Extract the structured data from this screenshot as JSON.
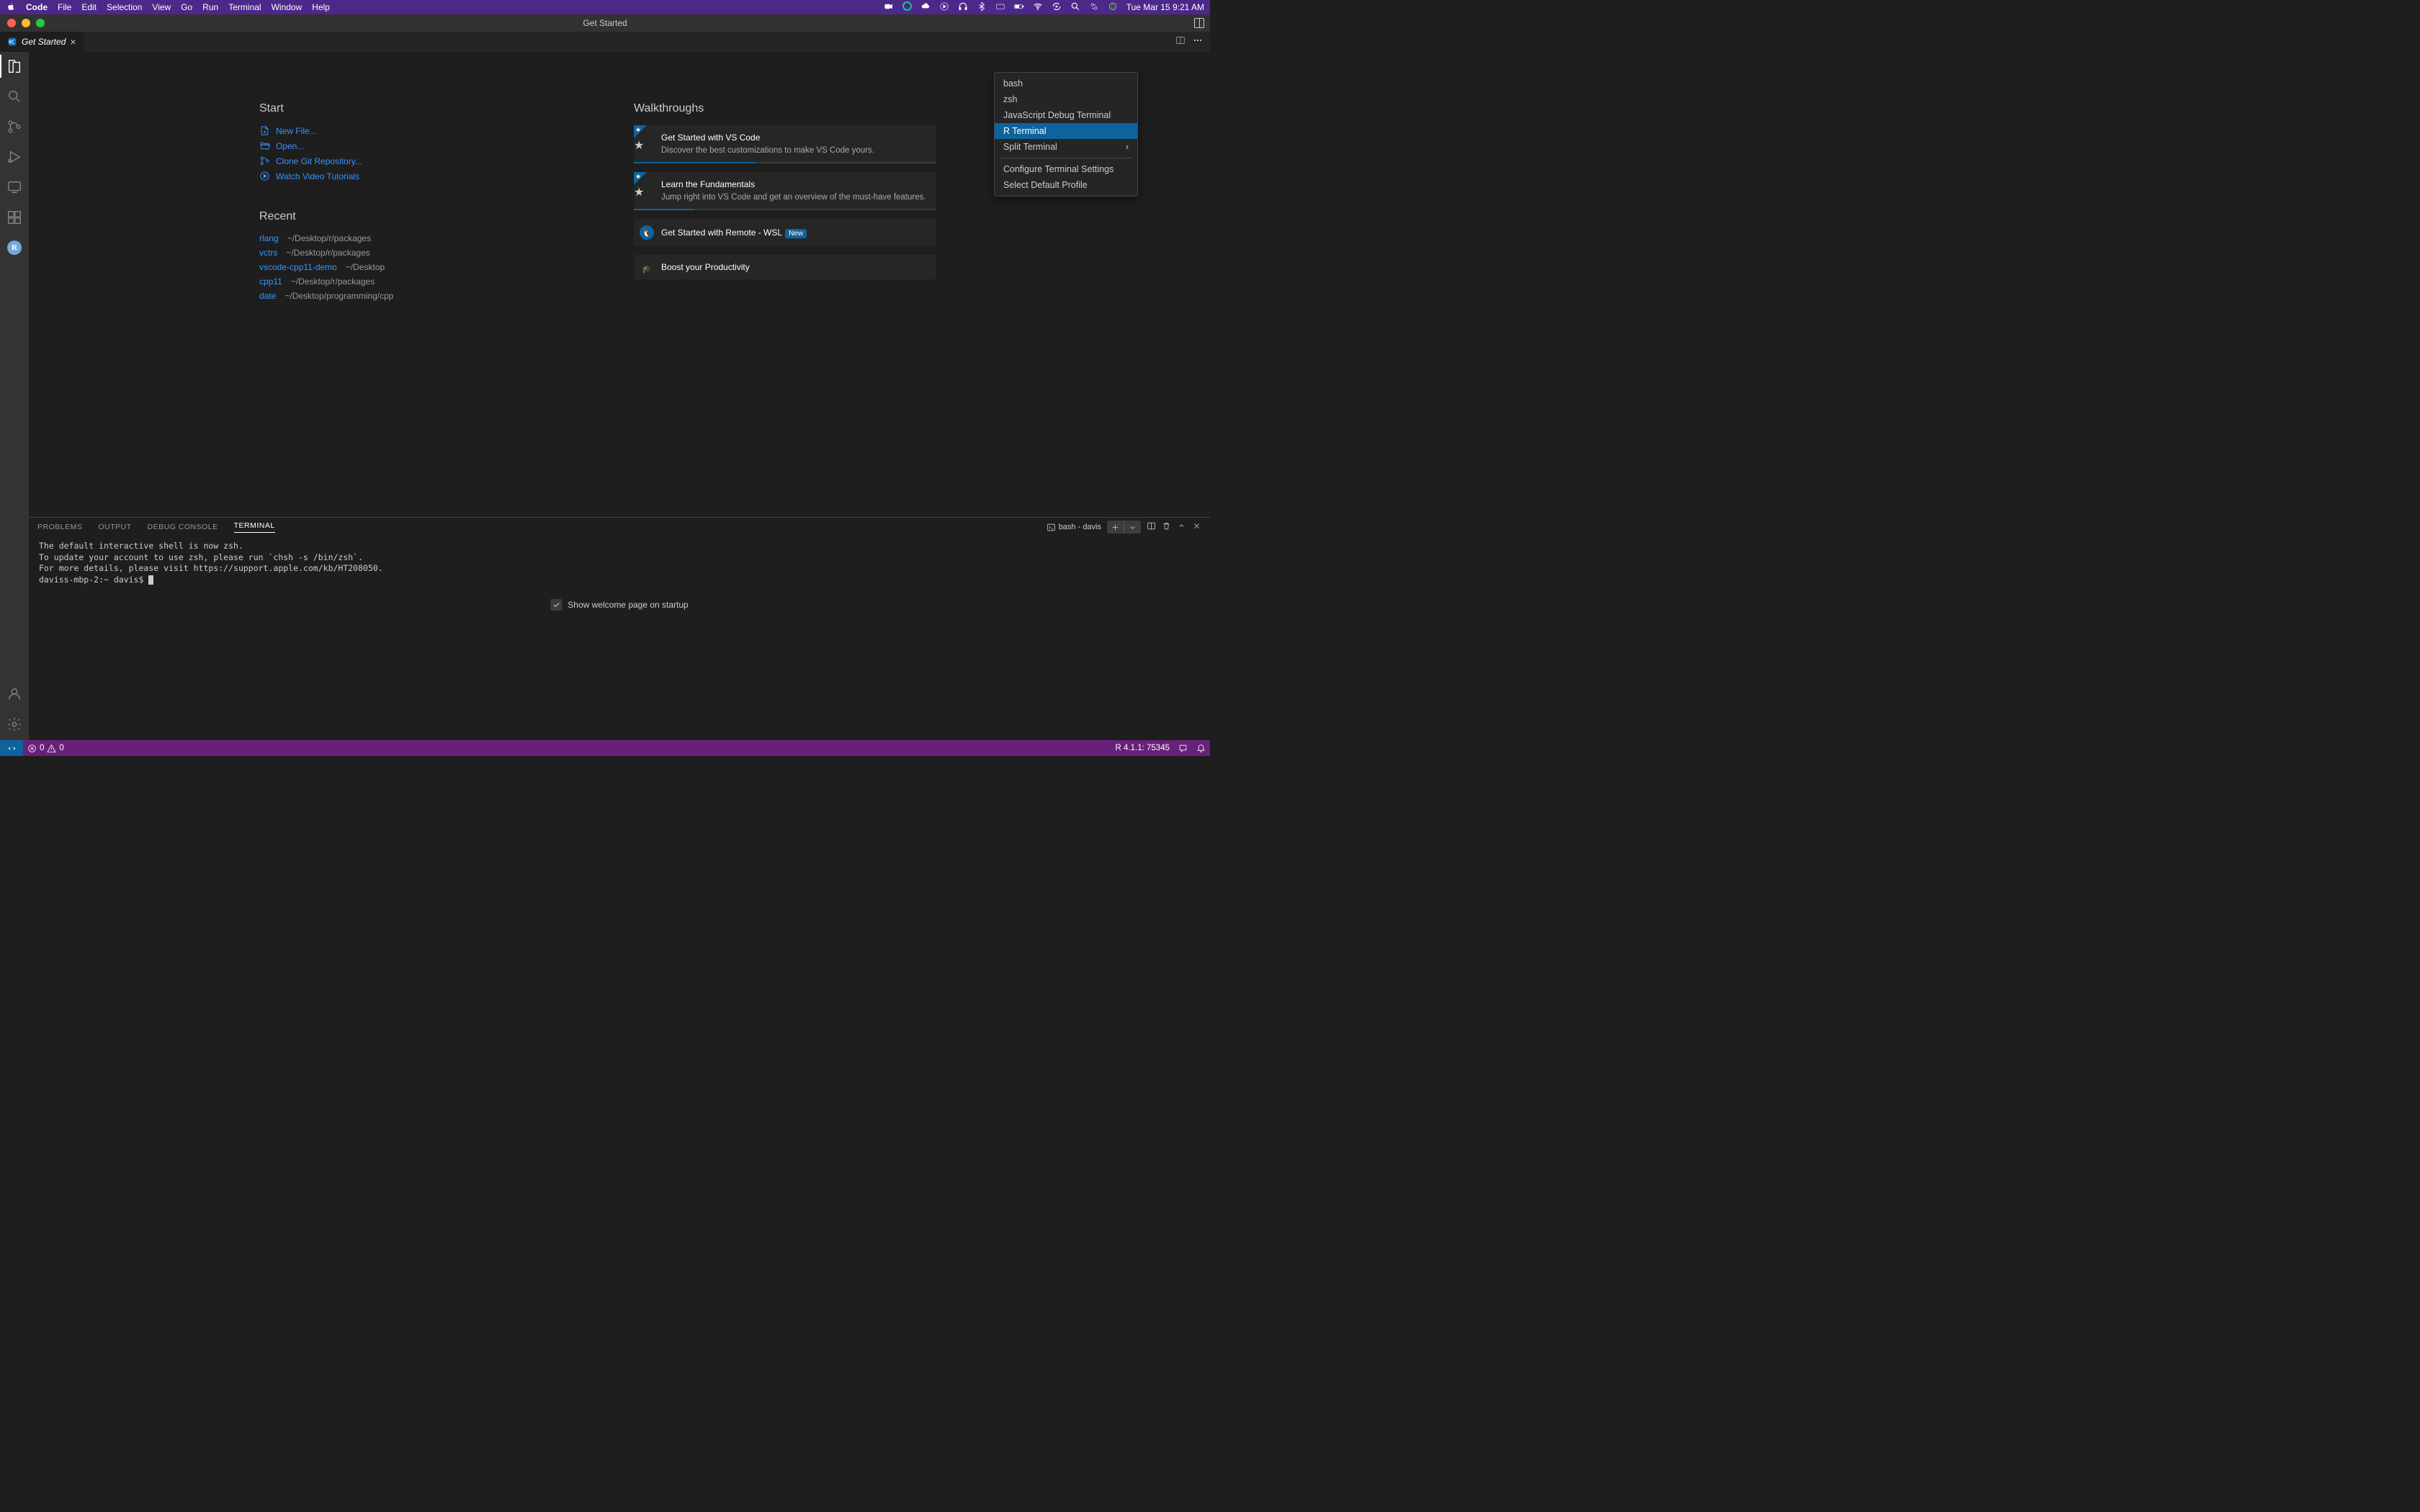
{
  "menubar": {
    "app": "Code",
    "items": [
      "File",
      "Edit",
      "Selection",
      "View",
      "Go",
      "Run",
      "Terminal",
      "Window",
      "Help"
    ],
    "clock": "Tue Mar 15  9:21 AM"
  },
  "titlebar": {
    "title": "Get Started"
  },
  "tab": {
    "title": "Get Started"
  },
  "welcome": {
    "start_heading": "Start",
    "start_links": {
      "newfile": "New File...",
      "open": "Open...",
      "clone": "Clone Git Repository...",
      "watch": "Watch Video Tutorials"
    },
    "recent_heading": "Recent",
    "recent": [
      {
        "name": "rlang",
        "path": "~/Desktop/r/packages"
      },
      {
        "name": "vctrs",
        "path": "~/Desktop/r/packages"
      },
      {
        "name": "vscode-cpp11-demo",
        "path": "~/Desktop"
      },
      {
        "name": "cpp11",
        "path": "~/Desktop/r/packages"
      },
      {
        "name": "date",
        "path": "~/Desktop/programming/cpp"
      }
    ],
    "walk_heading": "Walkthroughs",
    "walk": [
      {
        "title": "Get Started with VS Code",
        "desc": "Discover the best customizations to make VS Code yours.",
        "featured": true,
        "progress": 40
      },
      {
        "title": "Learn the Fundamentals",
        "desc": "Jump right into VS Code and get an overview of the must-have features.",
        "featured": true,
        "progress": 20
      },
      {
        "title": "Get Started with Remote - WSL",
        "new_badge": "New",
        "icon": "penguin"
      },
      {
        "title": "Boost your Productivity"
      }
    ],
    "show_welcome": "Show welcome page on startup"
  },
  "panel": {
    "tabs": {
      "problems": "PROBLEMS",
      "output": "OUTPUT",
      "debug": "DEBUG CONSOLE",
      "terminal": "TERMINAL"
    },
    "term_label": "bash - davis",
    "output_lines": [
      "The default interactive shell is now zsh.",
      "To update your account to use zsh, please run `chsh -s /bin/zsh`.",
      "For more details, please visit https://support.apple.com/kb/HT208050.",
      "daviss-mbp-2:~ davis$ "
    ]
  },
  "dropdown": {
    "items": [
      "bash",
      "zsh",
      "JavaScript Debug Terminal",
      "R Terminal",
      "Split Terminal"
    ],
    "config": "Configure Terminal Settings",
    "select_default": "Select Default Profile",
    "selected_index": 3
  },
  "statusbar": {
    "errors": "0",
    "warnings": "0",
    "r_version": "R 4.1.1: 75345"
  }
}
